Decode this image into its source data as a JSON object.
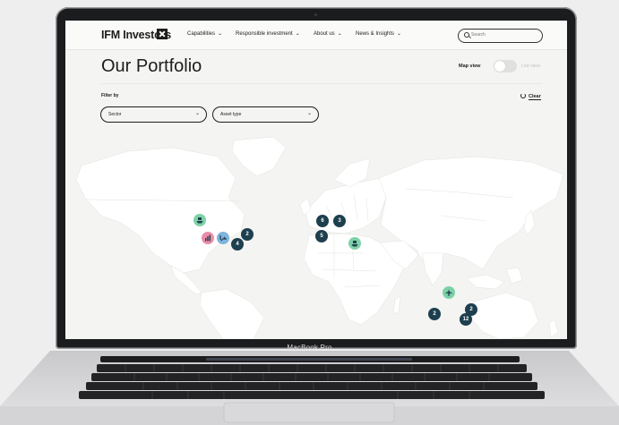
{
  "device": {
    "chin_label": "MacBook Pro"
  },
  "nav": {
    "logo": "IFM Investors",
    "items": [
      {
        "label": "Capabilities"
      },
      {
        "label": "Responsible investment"
      },
      {
        "label": "About us"
      },
      {
        "label": "News & Insights"
      }
    ],
    "search_placeholder": "Search"
  },
  "header": {
    "title": "Our Portfolio",
    "map_view_label": "Map view",
    "list_view_label": "List view"
  },
  "filters": {
    "label": "Filter by",
    "clear_label": "Clear",
    "sector": {
      "selected": "Sector"
    },
    "asset_type": {
      "selected": "Asset type"
    }
  },
  "map": {
    "land_color": "#ffffff",
    "cluster_color": "#1d3f4e",
    "clusters": [
      {
        "count": "2"
      },
      {
        "count": "4"
      },
      {
        "count": "6"
      },
      {
        "count": "3"
      },
      {
        "count": "5"
      },
      {
        "count": "2"
      },
      {
        "count": "2"
      },
      {
        "count": "12"
      }
    ],
    "assets": [
      {
        "icon": "port-icon",
        "color": "#7ed1a8"
      },
      {
        "icon": "bar-chart-icon",
        "color": "#ea8ca8"
      },
      {
        "icon": "transport-icon",
        "color": "#7fb4dd"
      },
      {
        "icon": "port-icon",
        "color": "#7ed1a8"
      },
      {
        "icon": "airport-icon",
        "color": "#7ed1a8"
      }
    ]
  }
}
